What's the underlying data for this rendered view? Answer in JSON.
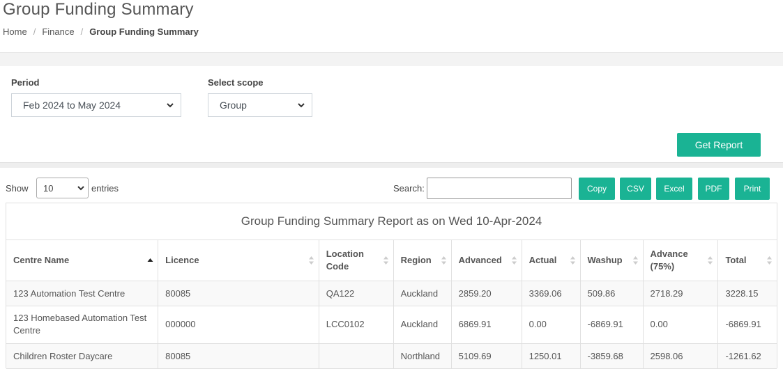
{
  "header": {
    "title": "Group Funding Summary",
    "breadcrumb": [
      "Home",
      "Finance",
      "Group Funding Summary"
    ]
  },
  "filters": {
    "period_label": "Period",
    "period_value": "Feb 2024 to May 2024",
    "scope_label": "Select scope",
    "scope_value": "Group",
    "get_report_label": "Get Report"
  },
  "table_controls": {
    "show_label": "Show",
    "entries_value": "10",
    "entries_label": "entries",
    "search_label": "Search:",
    "search_value": "",
    "export_buttons": [
      "Copy",
      "CSV",
      "Excel",
      "PDF",
      "Print"
    ]
  },
  "report": {
    "caption": "Group Funding Summary Report as on Wed 10-Apr-2024",
    "columns": [
      "Centre Name",
      "Licence",
      "Location Code",
      "Region",
      "Advanced",
      "Actual",
      "Washup",
      "Advance (75%)",
      "Total"
    ],
    "sorted_column": "Centre Name",
    "sort_direction": "ascending",
    "rows": [
      [
        "123 Automation Test Centre",
        "80085",
        "QA122",
        "Auckland",
        "2859.20",
        "3369.06",
        "509.86",
        "2718.29",
        "3228.15"
      ],
      [
        "123 Homebased Automation Test Centre",
        "000000",
        "LCC0102",
        "Auckland",
        "6869.91",
        "0.00",
        "-6869.91",
        "0.00",
        "-6869.91"
      ],
      [
        "Children Roster Daycare",
        "80085",
        "",
        "Northland",
        "5109.69",
        "1250.01",
        "-3859.68",
        "2598.06",
        "-1261.62"
      ]
    ]
  },
  "colors": {
    "accent": "#1ab394",
    "band": "#f3f3f3",
    "row_stripe": "#f9f9f9"
  }
}
